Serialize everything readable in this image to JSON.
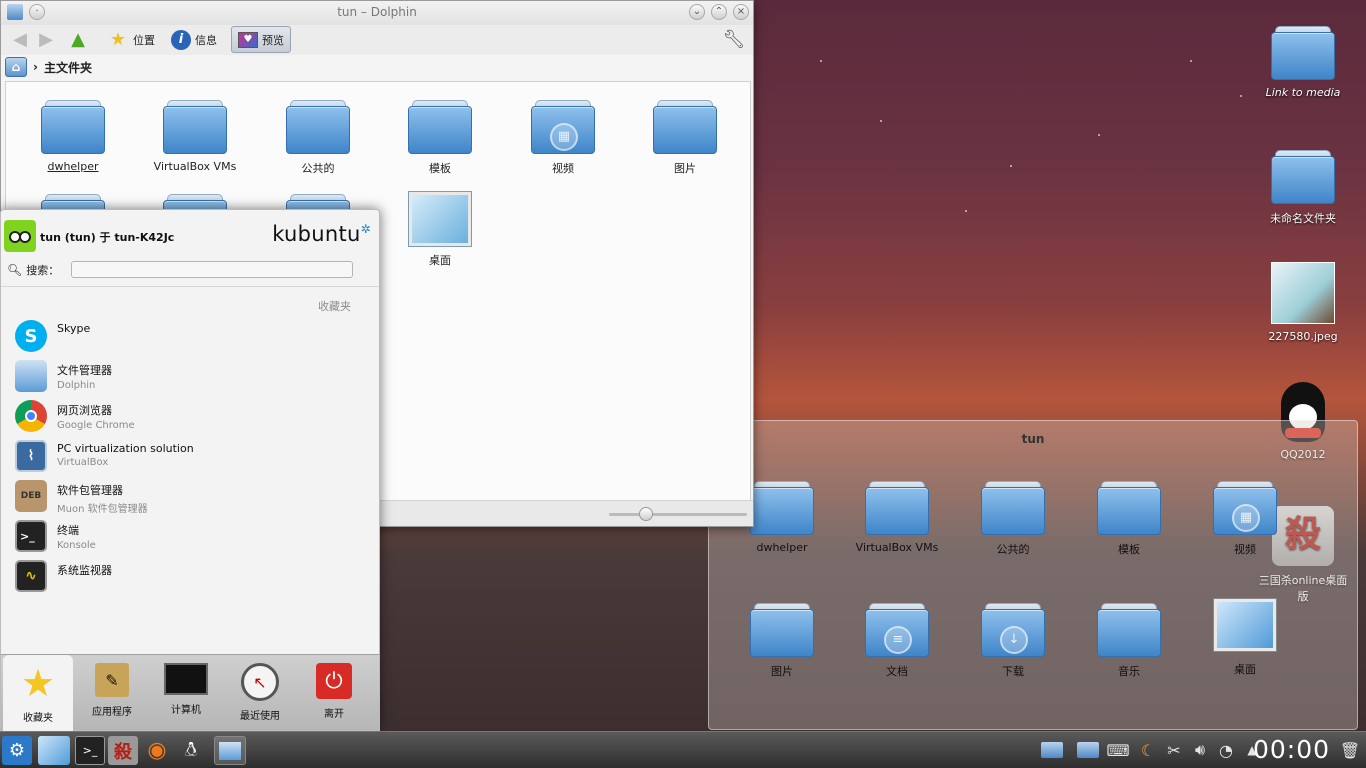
{
  "dolphin": {
    "title": "tun – Dolphin",
    "toolbar": {
      "places": "位置",
      "info": "信息",
      "preview": "预览"
    },
    "breadcrumb": "主文件夹",
    "folders": [
      {
        "label": "dwhelper"
      },
      {
        "label": "VirtualBox VMs"
      },
      {
        "label": "公共的"
      },
      {
        "label": "模板"
      },
      {
        "label": "视频"
      },
      {
        "label": "图片"
      },
      {
        "label": "桌面"
      }
    ]
  },
  "kickoff": {
    "user": "tun (tun) 于 tun-K42Jc",
    "brand": "kubuntu",
    "search_label": "搜索：",
    "section": "收藏夹",
    "apps": [
      {
        "name": "Skype",
        "sub": ""
      },
      {
        "name": "文件管理器",
        "sub": "Dolphin"
      },
      {
        "name": "网页浏览器",
        "sub": "Google Chrome"
      },
      {
        "name": "PC virtualization solution",
        "sub": "VirtualBox"
      },
      {
        "name": "软件包管理器",
        "sub": "Muon 软件包管理器"
      },
      {
        "name": "终端",
        "sub": "Konsole"
      },
      {
        "name": "系统监视器",
        "sub": ""
      }
    ],
    "tabs": [
      "收藏夹",
      "应用程序",
      "计算机",
      "最近使用",
      "离开"
    ]
  },
  "folderview": {
    "title": "tun",
    "items": [
      "dwhelper",
      "VirtualBox VMs",
      "公共的",
      "模板",
      "视频",
      "图片",
      "文档",
      "下载",
      "音乐",
      "桌面"
    ]
  },
  "desktop": {
    "icons": [
      "Link to media",
      "未命名文件夹",
      "227580.jpeg",
      "QQ2012",
      "三国杀online桌面版"
    ]
  },
  "panel": {
    "clock": "00:00"
  },
  "colors": {
    "folder": "#5b9bd8",
    "skype": "#00aff0",
    "kde_blue": "#2683c6"
  }
}
